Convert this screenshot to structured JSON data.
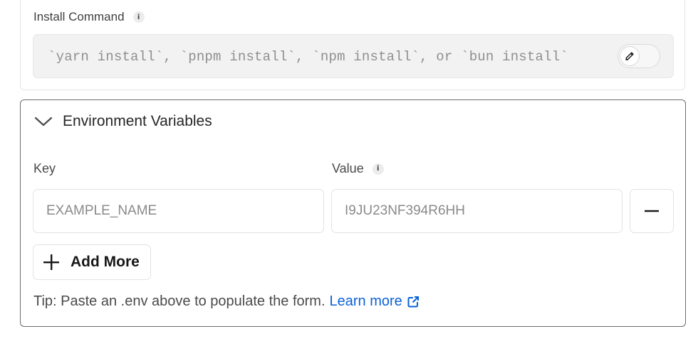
{
  "install": {
    "label": "Install Command",
    "placeholder": "`yarn install`, `pnpm install`, `npm install`, or `bun install`",
    "value": ""
  },
  "env": {
    "title": "Environment Variables",
    "expanded": true,
    "key_label": "Key",
    "value_label": "Value",
    "rows": [
      {
        "key_placeholder": "EXAMPLE_NAME",
        "value_placeholder": "I9JU23NF394R6HH",
        "key": "",
        "value": ""
      }
    ],
    "add_more_label": "Add More",
    "tip_text": "Tip: Paste an .env above to populate the form.",
    "learn_more_label": "Learn more"
  },
  "icons": {
    "info": "info-icon",
    "edit": "pencil-icon",
    "collapse": "chevron-down-icon",
    "remove": "minus-icon",
    "add": "plus-icon",
    "external": "external-link-icon"
  },
  "colors": {
    "link": "#0b62d6",
    "input_bg_disabled": "#f2f2f2",
    "border": "#e3e3e3",
    "card_border_active": "#6b6b6b"
  }
}
